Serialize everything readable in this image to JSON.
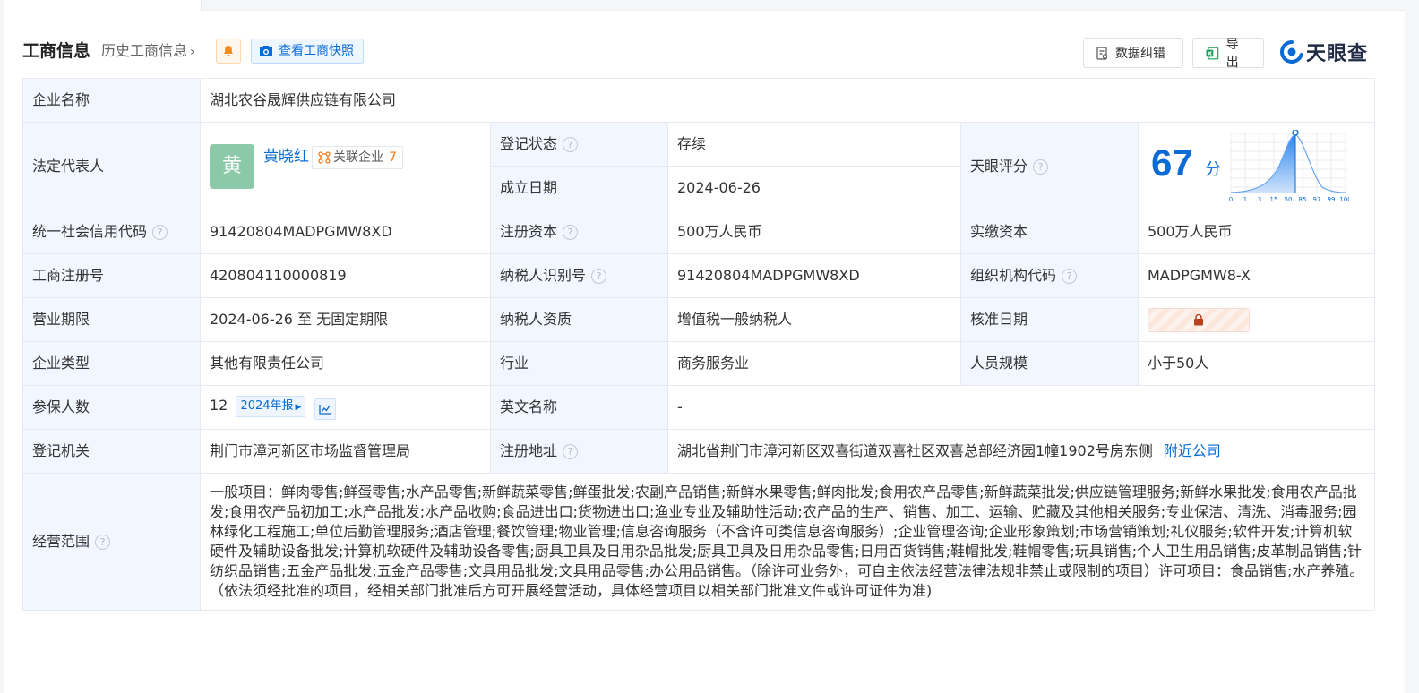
{
  "header": {
    "title": "工商信息",
    "history_link": "历史工商信息",
    "snapshot_button": "查看工商快照",
    "data_fix_button": "数据纠错",
    "export_button": "导出",
    "logo_text": "天眼查"
  },
  "info": {
    "company_name_label": "企业名称",
    "company_name": "湖北农谷晟辉供应链有限公司",
    "legal_rep_label": "法定代表人",
    "legal_rep_avatar": "黄",
    "legal_rep_name": "黄晓红",
    "related_label": "关联企业",
    "related_count": "7",
    "reg_status_label": "登记状态",
    "reg_status": "存续",
    "est_date_label": "成立日期",
    "est_date": "2024-06-26",
    "tianyan_score_label": "天眼评分",
    "tianyan_score": "67",
    "tianyan_score_unit": "分",
    "score_axis_ticks": [
      "0",
      "1",
      "3",
      "15",
      "50",
      "85",
      "97",
      "99",
      "100"
    ],
    "credit_code_label": "统一社会信用代码",
    "credit_code": "91420804MADPGMW8XD",
    "reg_capital_label": "注册资本",
    "reg_capital": "500万人民币",
    "paid_capital_label": "实缴资本",
    "paid_capital": "500万人民币",
    "biz_reg_no_label": "工商注册号",
    "biz_reg_no": "420804110000819",
    "taxpayer_id_label": "纳税人识别号",
    "taxpayer_id": "91420804MADPGMW8XD",
    "org_code_label": "组织机构代码",
    "org_code": "MADPGMW8-X",
    "term_label": "营业期限",
    "term": "2024-06-26 至 无固定期限",
    "taxpayer_qual_label": "纳税人资质",
    "taxpayer_qual": "增值税一般纳税人",
    "approval_date_label": "核准日期",
    "company_type_label": "企业类型",
    "company_type": "其他有限责任公司",
    "industry_label": "行业",
    "industry": "商务服务业",
    "staff_size_label": "人员规模",
    "staff_size": "小于50人",
    "insured_label": "参保人数",
    "insured": "12",
    "insured_year_badge": "2024年报",
    "english_name_label": "英文名称",
    "english_name": "-",
    "reg_authority_label": "登记机关",
    "reg_authority": "荆门市漳河新区市场监督管理局",
    "reg_address_label": "注册地址",
    "reg_address": "湖北省荆门市漳河新区双喜街道双喜社区双喜总部经济园1幢1902号房东侧",
    "nearby_link": "附近公司",
    "scope_label": "经营范围",
    "scope": "一般项目：鲜肉零售;鲜蛋零售;水产品零售;新鲜蔬菜零售;鲜蛋批发;农副产品销售;新鲜水果零售;鲜肉批发;食用农产品零售;新鲜蔬菜批发;供应链管理服务;新鲜水果批发;食用农产品批发;食用农产品初加工;水产品批发;水产品收购;食品进出口;货物进出口;渔业专业及辅助性活动;农产品的生产、销售、加工、运输、贮藏及其他相关服务;专业保洁、清洗、消毒服务;园林绿化工程施工;单位后勤管理服务;酒店管理;餐饮管理;物业管理;信息咨询服务（不含许可类信息咨询服务）;企业管理咨询;企业形象策划;市场营销策划;礼仪服务;软件开发;计算机软硬件及辅助设备批发;计算机软硬件及辅助设备零售;厨具卫具及日用杂品批发;厨具卫具及日用杂品零售;日用百货销售;鞋帽批发;鞋帽零售;玩具销售;个人卫生用品销售;皮革制品销售;针纺织品销售;五金产品批发;五金产品零售;文具用品批发;文具用品零售;办公用品销售。（除许可业务外，可自主依法经营法律法规非禁止或限制的项目）许可项目：食品销售;水产养殖。（依法须经批准的项目，经相关部门批准后方可开展经营活动，具体经营项目以相关部门批准文件或许可证件为准)"
  },
  "icons": {
    "help": "help-circle-icon",
    "bell": "bell-icon",
    "camera": "camera-icon",
    "lock": "lock-icon"
  },
  "colors": {
    "accent": "#0a6bd6",
    "status_green": "#2fa84f",
    "label_bg": "#f1f6ff",
    "avatar_bg": "#8bc9a8"
  }
}
